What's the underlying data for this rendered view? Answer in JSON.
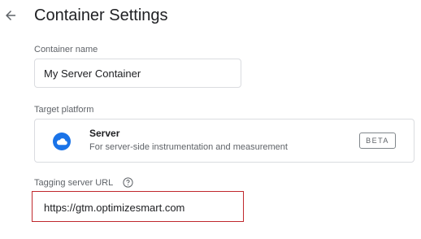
{
  "header": {
    "title": "Container Settings",
    "back_icon": "arrow-back-icon"
  },
  "container_name": {
    "label": "Container name",
    "value": "My Server Container"
  },
  "target_platform": {
    "label": "Target platform",
    "name": "Server",
    "description": "For server-side instrumentation and measurement",
    "badge": "BETA",
    "icon": "cloud-icon",
    "icon_color": "#1a73e8"
  },
  "tagging_server": {
    "label": "Tagging server URL",
    "help_icon": "help-circle-icon",
    "value": "https://gtm.optimizesmart.com",
    "highlight_color": "#c0282d"
  }
}
